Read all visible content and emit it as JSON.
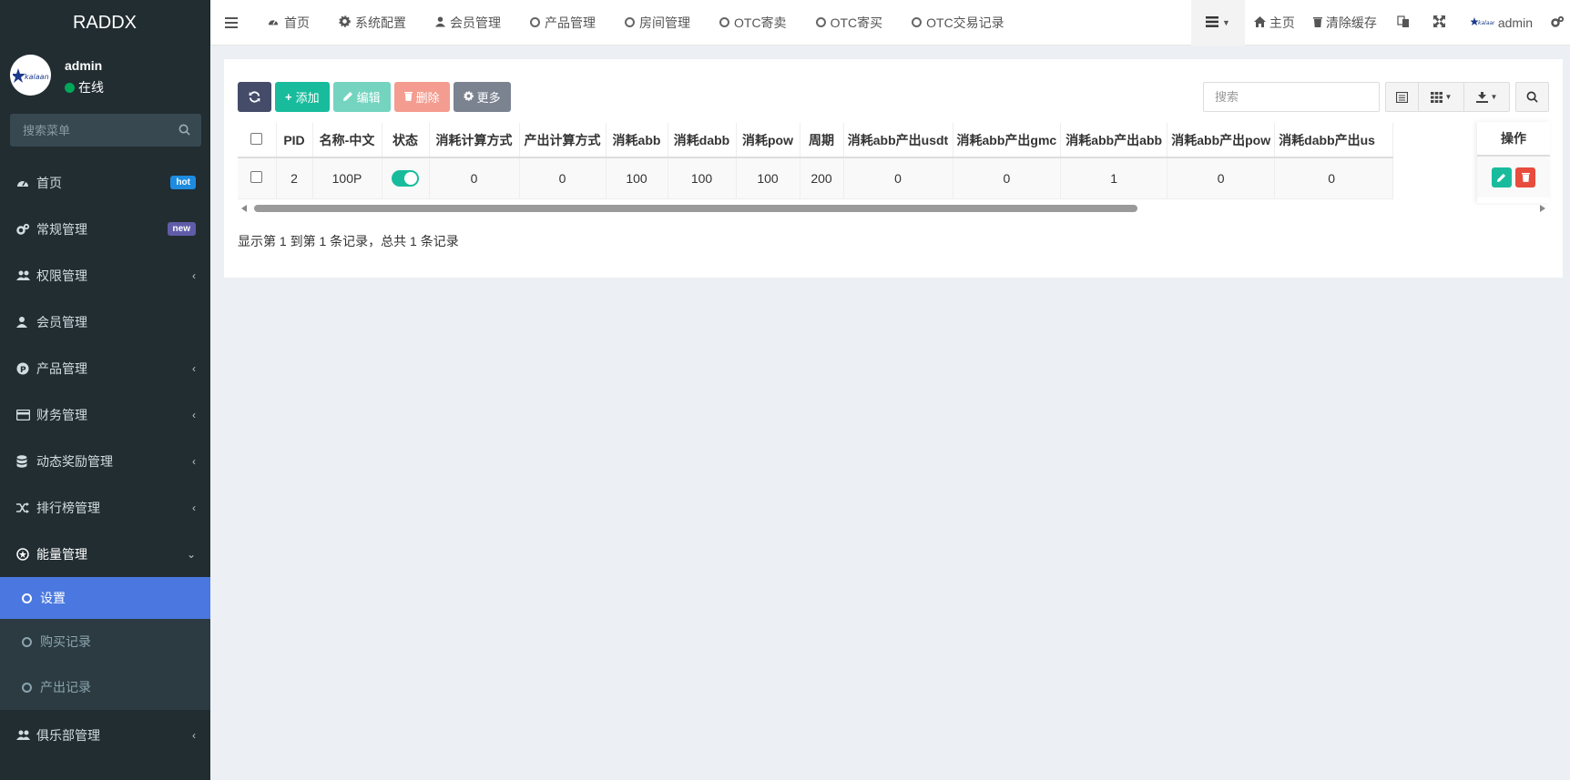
{
  "brand": "RADDX",
  "user": {
    "name": "admin",
    "status": "在线"
  },
  "sidebar_search": {
    "placeholder": "搜索菜单"
  },
  "menu": [
    {
      "label": "首页",
      "icon": "dashboard-icon",
      "badge": "hot"
    },
    {
      "label": "常规管理",
      "icon": "cogs-icon",
      "badge": "new"
    },
    {
      "label": "权限管理",
      "icon": "users-icon",
      "chevron": "left"
    },
    {
      "label": "会员管理",
      "icon": "user-icon"
    },
    {
      "label": "产品管理",
      "icon": "product-icon",
      "chevron": "left"
    },
    {
      "label": "财务管理",
      "icon": "card-icon",
      "chevron": "left"
    },
    {
      "label": "动态奖励管理",
      "icon": "database-icon",
      "chevron": "left"
    },
    {
      "label": "排行榜管理",
      "icon": "random-icon",
      "chevron": "left"
    },
    {
      "label": "能量管理",
      "icon": "energy-icon",
      "chevron": "down"
    }
  ],
  "submenu": [
    {
      "label": "设置",
      "active": true
    },
    {
      "label": "购买记录"
    },
    {
      "label": "产出记录"
    }
  ],
  "menu_last": {
    "label": "俱乐部管理",
    "icon": "users-icon"
  },
  "topnav": [
    {
      "label": "首页",
      "icon": "dashboard-icon"
    },
    {
      "label": "系统配置",
      "icon": "gear-icon"
    },
    {
      "label": "会员管理",
      "icon": "user-icon"
    },
    {
      "label": "产品管理",
      "icon": "ring-icon"
    },
    {
      "label": "房间管理",
      "icon": "ring-icon"
    },
    {
      "label": "OTC寄卖",
      "icon": "ring-icon"
    },
    {
      "label": "OTC寄买",
      "icon": "ring-icon"
    },
    {
      "label": "OTC交易记录",
      "icon": "ring-icon"
    }
  ],
  "topright": {
    "home": "主页",
    "clear_cache": "清除缓存",
    "user": "admin"
  },
  "toolbar": {
    "add": "添加",
    "edit": "编辑",
    "delete": "删除",
    "more": "更多"
  },
  "search": {
    "placeholder": "搜索"
  },
  "table": {
    "columns": [
      "PID",
      "名称-中文",
      "状态",
      "消耗计算方式",
      "产出计算方式",
      "消耗abb",
      "消耗dabb",
      "消耗pow",
      "周期",
      "消耗abb产出usdt",
      "消耗abb产出gmc",
      "消耗abb产出abb",
      "消耗abb产出pow",
      "消耗dabb产出us"
    ],
    "rows": [
      [
        "2",
        "100P",
        "",
        "0",
        "0",
        "100",
        "100",
        "100",
        "200",
        "0",
        "0",
        "1",
        "0",
        "0"
      ]
    ],
    "op_header": "操作"
  },
  "pagination_info": "显示第 1 到第 1 条记录，总共 1 条记录",
  "colors": {
    "sidebar": "#222d32",
    "active": "#4a78e0",
    "success": "#18bc9c",
    "danger": "#e74c3c"
  }
}
